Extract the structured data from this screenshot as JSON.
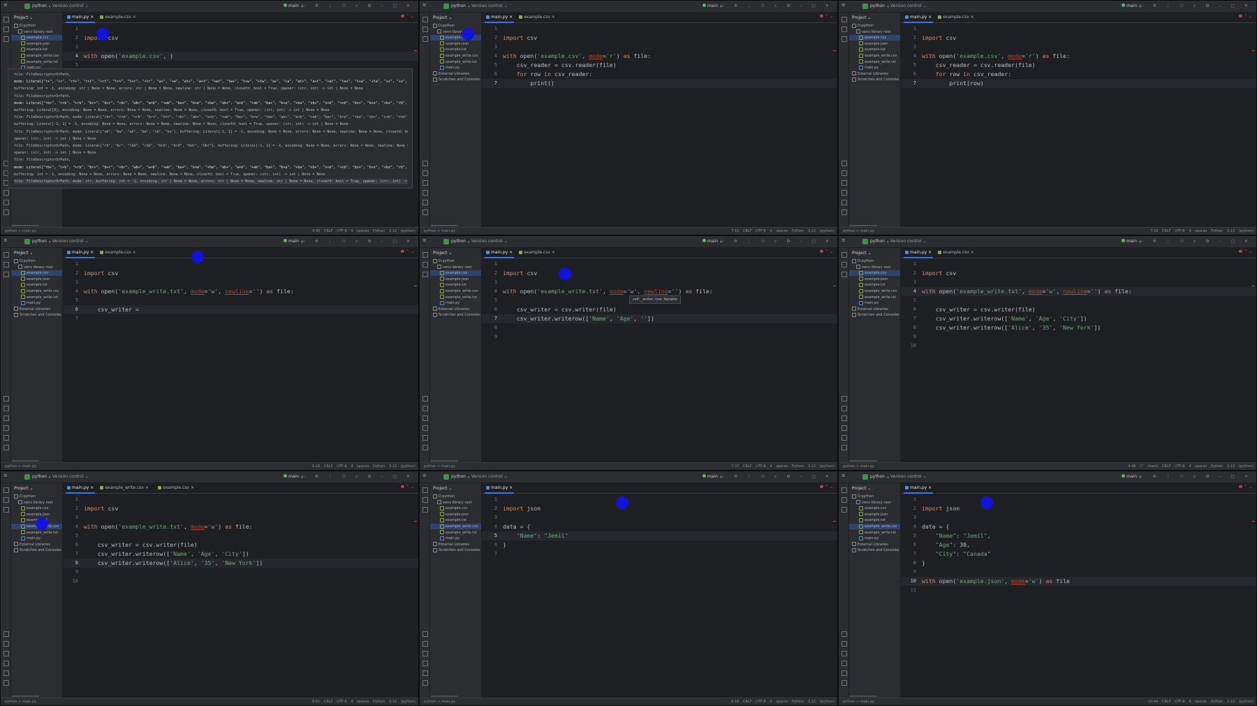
{
  "titlebar": {
    "project": "python",
    "vcs": "Version control",
    "branch": "main"
  },
  "project_label": "Project",
  "panes": [
    {
      "tabs": [
        "main.py",
        "example.csv"
      ],
      "status_left": "python > main.py",
      "status_right": "4:30  CRLF  UTF-8  4 spaces  Python 3.12 (python)",
      "tree": [
        "D:python",
        "venv library root",
        "example.csv",
        "example.json",
        "example.txt",
        "example_write.csv",
        "example_write.txt",
        "main.py"
      ],
      "tree_sel": 2,
      "lines": [
        "",
        "import csv",
        "",
        "with open('example.csv', )",
        "",
        "",
        ""
      ],
      "cur_line": 4,
      "tooltip": [
        "file: FileDescriptorOrPath,",
        "mode: Literal[\"r+\", \"+r\", \"rt+\", \"r+t\", \"+rt\", \"tr+\", \"t+r\", \"+tr\", \"w+\", \"+w\", \"wt+\", \"w+t\", \"+wt\", \"tw+\", \"t+w\", \"+tw\", \"a+\", \"+a\", \"at+\", \"a+t\", \"+at\", \"ta+\", \"t+a\", \"+ta\", \"x+\", \"+x\", \"xt+\", \"x+t\", \"+xt\", \"tx+\", \"t+x\", \"+tx\"",
        "buffering: int = -1, encoding: str | None = None, errors: str | None = None, newline: str | None = None, closefd: bool = True, opener: (str, int) -> int | None = None",
        "file: FileDescriptorOrPath,",
        "mode: Literal[\"rb+\", \"r+b\", \"+rb\", \"br+\", \"b+r\", \"+br\", \"wb+\", \"w+b\", \"+wb\", \"bw+\", \"b+w\", \"+bw\", \"ab+\", \"a+b\", \"+ab\", \"ba+\", \"b+a\", \"+ba\", \"xb+\", \"x+b\", \"+xb\", \"bx+\", \"b+x\", \"+bx\", \"rb\", \"br\", \"rbU\"",
        "buffering: Literal[0], encoding: None = None, errors: None = None, newline: None = None, closefd: bool = True, opener: (str, int) -> int | None = None",
        "file: FileDescriptorOrPath, mode: Literal[\"rb+\", \"r+b\", \"+rb\", \"br+\", \"b+r\", \"+br\", \"wb+\", \"w+b\", \"+wb\", \"bw+\", \"b+w\", \"+bw\", \"ab+\", \"a+b\", \"+ab\", \"ba+\", \"b+a\", \"+ba\", \"xb+\", \"x+b\", \"+xb\"",
        "buffering: Literal[-1, 1] = -1, encoding: None = None, errors: None = None, newline: None = None, closefd: bool = True, opener: (str, int) -> int | None = None",
        "file: FileDescriptorOrPath, mode: Literal[\"wb\", \"bw\", \"ab\", \"ba\", \"xb\", \"bx\"], buffering: Literal[-1, 1] = -1, encoding: None = None, errors: None = None, newline: None = None, closefd: bool = True,",
        "opener: (str, int) -> int | None = None",
        "file: FileDescriptorOrPath, mode: Literal[\"rb\", \"br\", \"rbU\", \"rUb\", \"Urb\", \"brU\", \"bUr\", \"Ubr\"], buffering: Literal[-1, 1] = -1, encoding: None = None, errors: None = None, newline: None = None, closefd: bool = True,",
        "opener: (str, int) -> int | None = None",
        "file: FileDescriptorOrPath,",
        "mode: Literal[\"rb+\", \"r+b\", \"+rb\", \"br+\", \"b+r\", \"+br\", \"wb+\", \"w+b\", \"+wb\", \"bw+\", \"b+w\", \"+bw\", \"ab+\", \"a+b\", \"+ab\", \"ba+\", \"b+a\", \"+ba\", \"xb+\", \"x+b\", \"+xb\", \"bx+\", \"b+x\", \"+bx\", \"rb\", \"br\", \"rbU\"",
        "buffering: int = -1, encoding: None = None, errors: None = None, newline: None = None, closefd: bool = True, opener: (str, int) -> int | None = None",
        "file: FileDescriptorOrPath, mode: str, buffering: int = -1, encoding: str | None = None, errors: str | None = None, newline: str | None = None, closefd: bool = True, opener: (str, int) -> int | None = None"
      ]
    },
    {
      "tabs": [
        "main.py",
        "example.csv"
      ],
      "status_left": "python > main.py",
      "status_right": "7:15  CRLF  UTF-8  4 spaces  Python 3.12 (python)",
      "tree": [
        "D:python",
        "venv library root",
        "example.csv",
        "example.json",
        "example.txt",
        "example_write.csv",
        "example_write.txt",
        "main.py",
        "External Libraries",
        "Scratches and Consoles"
      ],
      "tree_sel": 2,
      "lines": [
        "",
        "import csv",
        "",
        "with open('example.csv', mode='r') as file:",
        "    csv_reader = csv.reader(file)",
        "    for row in csv_reader:",
        "        print()"
      ],
      "cur_line": 7
    },
    {
      "tabs": [
        "main.py",
        "example.csv"
      ],
      "status_left": "python > main.py",
      "status_right": "7:16  CRLF  UTF-8  4 spaces  Python 3.12 (python)",
      "tree": [
        "D:python",
        "venv library root",
        "example.csv",
        "example.json",
        "example.txt",
        "example_write.csv",
        "example_write.txt",
        "main.py",
        "External Libraries",
        "Scratches and Consoles"
      ],
      "tree_sel": 2,
      "lines": [
        "",
        "import csv",
        "",
        "with open('example.csv', mode='r') as file:",
        "    csv_reader = csv.reader(file)",
        "    for row in csv_reader:",
        "        print(row)"
      ],
      "cur_line": 7
    },
    {
      "tabs": [
        "main.py",
        "example.csv"
      ],
      "status_left": "python > main.py",
      "status_right": "6:16  CRLF  UTF-8  4 spaces  Python 3.12 (python)",
      "tree": [
        "D:python",
        "venv library root",
        "example.csv",
        "example.json",
        "example.txt",
        "example_write.csv",
        "example_write.txt",
        "main.py",
        "External Libraries",
        "Scratches and Consoles"
      ],
      "tree_sel": 2,
      "lines": [
        "",
        "import csv",
        "",
        "with open('example_write.txt', mode='w', newline='') as file:",
        "",
        "    csv_writer = ",
        ""
      ],
      "cur_line": 6
    },
    {
      "tabs": [
        "main.py",
        "example.csv"
      ],
      "status_left": "python > main.py",
      "status_right": "7:37  CRLF  UTF-8  4 spaces  Python 3.12 (python)",
      "tree": [
        "D:python",
        "venv library root",
        "example.csv",
        "example.json",
        "example.txt",
        "example_write.csv",
        "example_write.txt",
        "main.py",
        "External Libraries",
        "Scratches and Consoles"
      ],
      "tree_sel": 2,
      "lines": [
        "",
        "import csv",
        "",
        "with open('example_write.txt', mode='w', newline='') as file:",
        "",
        "    csv_writer = csv.writer(file)",
        "    csv_writer.writerow(['Name', 'Age', ''])",
        "",
        ""
      ],
      "cur_line": 7,
      "mini_tip": "self: _writer, row: Iterable"
    },
    {
      "tabs": [
        "main.py",
        "example.csv"
      ],
      "status_left": "python > main.py",
      "status_right": "4:48 (7 chars)  CRLF  UTF-8  4 spaces  Python 3.12 (python)",
      "tree": [
        "D:python",
        "venv library root",
        "example.csv",
        "example.json",
        "example.txt",
        "example_write.csv",
        "example_write.txt",
        "main.py",
        "External Libraries",
        "Scratches and Consoles"
      ],
      "tree_sel": 2,
      "lines": [
        "",
        "import csv",
        "",
        "with open('example_write.txt', mode='w', newline='') as file:",
        "",
        "    csv_writer = csv.writer(file)",
        "    csv_writer.writerow(['Name', 'Age', 'City'])",
        "    csv_writer.writerow(['Alice', '35', 'New York'])",
        "",
        ""
      ],
      "cur_line": 4
    },
    {
      "tabs": [
        "main.py",
        "example_write.csv",
        "example.csv"
      ],
      "status_left": "python > main.py",
      "status_right": "8:51  CRLF  UTF-8  4 spaces  Python 3.12 (python)",
      "tree": [
        "D:python",
        "venv library root",
        "example.csv",
        "example.json",
        "example.txt",
        "example_write.csv",
        "example_write.txt",
        "main.py",
        "External Libraries",
        "Scratches and Consoles"
      ],
      "tree_sel": 5,
      "lines": [
        "",
        "import csv",
        "",
        "with open('example_write.txt', mode='w') as file:",
        "",
        "    csv_writer = csv.writer(file)",
        "    csv_writer.writerow(['Name', 'Age', 'City'])",
        "    csv_writer.writerow(['Alice', '35', 'New York'])",
        "",
        ""
      ],
      "cur_line": 8
    },
    {
      "tabs": [
        "main.py"
      ],
      "status_left": "python > main.py",
      "status_right": "5:18  CRLF  UTF-8  4 spaces  Python 3.12 (python)",
      "tree": [
        "D:python",
        "venv library root",
        "example.csv",
        "example.json",
        "example.txt",
        "example_write.csv",
        "example_write.txt",
        "main.py",
        "External Libraries",
        "Scratches and Consoles"
      ],
      "tree_sel": 5,
      "lines": [
        "",
        "import json",
        "",
        "data = {",
        "    \"Name\": \"Jemil\"",
        "}",
        ""
      ],
      "cur_line": 5
    },
    {
      "tabs": [
        "main.py"
      ],
      "status_left": "python > main.py",
      "status_right": "10:44  CRLF  UTF-8  4 spaces  Python 3.12 (python)",
      "tree": [
        "D:python",
        "venv library root",
        "example.csv",
        "example.json",
        "example.txt",
        "example_write.csv",
        "example_write.txt",
        "main.py",
        "External Libraries",
        "Scratches and Consoles"
      ],
      "tree_sel": 5,
      "lines": [
        "",
        "import json",
        "",
        "data = {",
        "    \"Name\": \"Jemil\",",
        "    \"Age\": 30,",
        "    \"City\": \"Canada\"",
        "}",
        "",
        "with open('example.json', mode='w') as file",
        ""
      ],
      "cur_line": 10
    }
  ]
}
